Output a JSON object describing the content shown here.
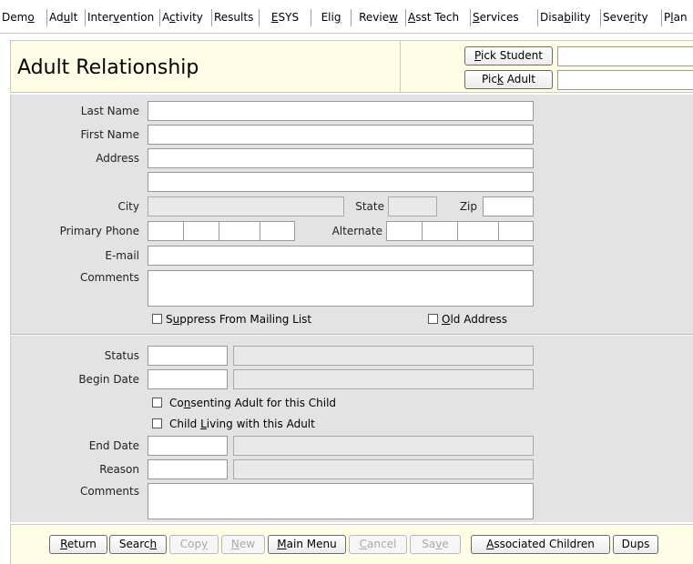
{
  "tabs": [
    {
      "pre": "Dem",
      "key": "o",
      "post": ""
    },
    {
      "pre": "Ad",
      "key": "u",
      "post": "lt"
    },
    {
      "pre": "Inter",
      "key": "v",
      "post": "ention"
    },
    {
      "pre": "A",
      "key": "c",
      "post": "tivity"
    },
    {
      "pre": "Results",
      "key": "",
      "post": ""
    },
    {
      "pre": "",
      "key": "E",
      "post": "SYS"
    },
    {
      "pre": "Eli",
      "key": "g",
      "post": ""
    },
    {
      "pre": "Revie",
      "key": "w",
      "post": ""
    },
    {
      "pre": "",
      "key": "A",
      "post": "sst Tech"
    },
    {
      "pre": "",
      "key": "S",
      "post": "ervices"
    },
    {
      "pre": "Disa",
      "key": "b",
      "post": "ility"
    },
    {
      "pre": "Seve",
      "key": "r",
      "post": "ity"
    },
    {
      "pre": "P",
      "key": "l",
      "post": "an"
    }
  ],
  "header": {
    "title": "Adult Relationship",
    "pick_student": {
      "pre": "",
      "key": "P",
      "post": "ick Student"
    },
    "pick_adult": {
      "pre": "Pic",
      "key": "k",
      "post": " Adult"
    },
    "student_value": "",
    "adult_value": ""
  },
  "contact": {
    "last_name_label": "Last Name",
    "first_name_label": "First Name",
    "address_label": "Address",
    "city_label": "City",
    "state_label": "State",
    "zip_label": "Zip",
    "primary_phone_label": "Primary Phone",
    "alternate_label": "Alternate",
    "email_label": "E-mail",
    "comments_label": "Comments",
    "suppress": {
      "pre": "S",
      "key": "u",
      "post": "ppress From Mailing List",
      "checked": false
    },
    "old_address": {
      "pre": "",
      "key": "O",
      "post": "ld Address",
      "checked": false
    }
  },
  "relationship": {
    "status_label": "Status",
    "begin_date_label": "Begin Date",
    "consenting": {
      "pre": "Co",
      "key": "n",
      "post": "senting Adult for this Child",
      "checked": false
    },
    "child_living": {
      "pre": "Child ",
      "key": "L",
      "post": "iving with this Adult",
      "checked": false
    },
    "end_date_label": "End Date",
    "reason_label": "Reason",
    "comments_label": "Comments"
  },
  "buttons": {
    "return": {
      "pre": "",
      "key": "R",
      "post": "eturn"
    },
    "search": {
      "pre": "Searc",
      "key": "h",
      "post": ""
    },
    "copy": {
      "pre": "Cop",
      "key": "y",
      "post": ""
    },
    "new": {
      "pre": "",
      "key": "N",
      "post": "ew"
    },
    "main_menu": {
      "pre": "",
      "key": "M",
      "post": "ain Menu"
    },
    "cancel": {
      "pre": "",
      "key": "C",
      "post": "ancel"
    },
    "save": {
      "pre": "Sa",
      "key": "v",
      "post": "e"
    },
    "associated_children": {
      "pre": "",
      "key": "A",
      "post": "ssociated Children"
    },
    "dups": {
      "pre": "Dups",
      "key": "",
      "post": ""
    }
  },
  "colors": {
    "header_bg": "#fffde6",
    "panel_bg": "#e3e3e3",
    "readonly_bg": "#e9e9e9"
  }
}
